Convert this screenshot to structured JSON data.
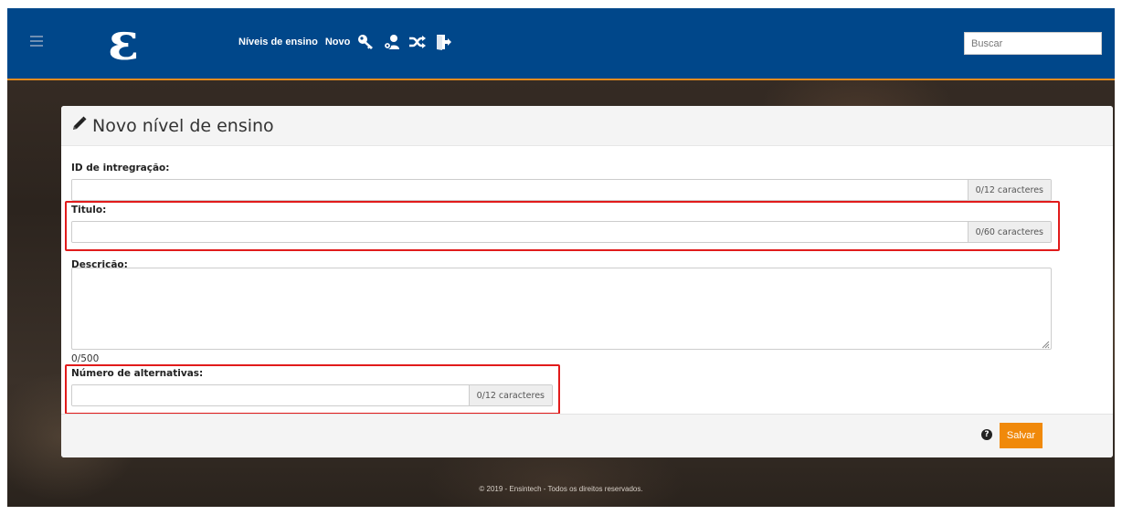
{
  "header": {
    "logo_text": "ε",
    "nav": {
      "link1": "Níveis de ensino",
      "link2": "Novo",
      "icons": [
        "key-icon",
        "user-settings-icon",
        "shuffle-icon",
        "exit-icon"
      ]
    },
    "search_placeholder": "Buscar",
    "colors": {
      "bar": "#00478a",
      "accent": "#e28a1d"
    }
  },
  "form": {
    "title": "Novo nível de ensino",
    "fields": {
      "integration_id": {
        "label": "ID de intregração:",
        "value": "",
        "counter": "0/12 caracteres"
      },
      "titulo": {
        "label": "Titulo:",
        "value": "",
        "counter": "0/60 caracteres"
      },
      "descricao": {
        "label": "Descrição:",
        "value": "",
        "counter": "0/500"
      },
      "alternativas": {
        "label": "Número de alternativas:",
        "value": "",
        "counter": "0/12 caracteres"
      }
    },
    "help_icon": "?",
    "save_label": "Salvar",
    "save_color": "#f0890b"
  },
  "footer": {
    "text": "© 2019 - Ensintech - Todos os direitos reservados."
  }
}
